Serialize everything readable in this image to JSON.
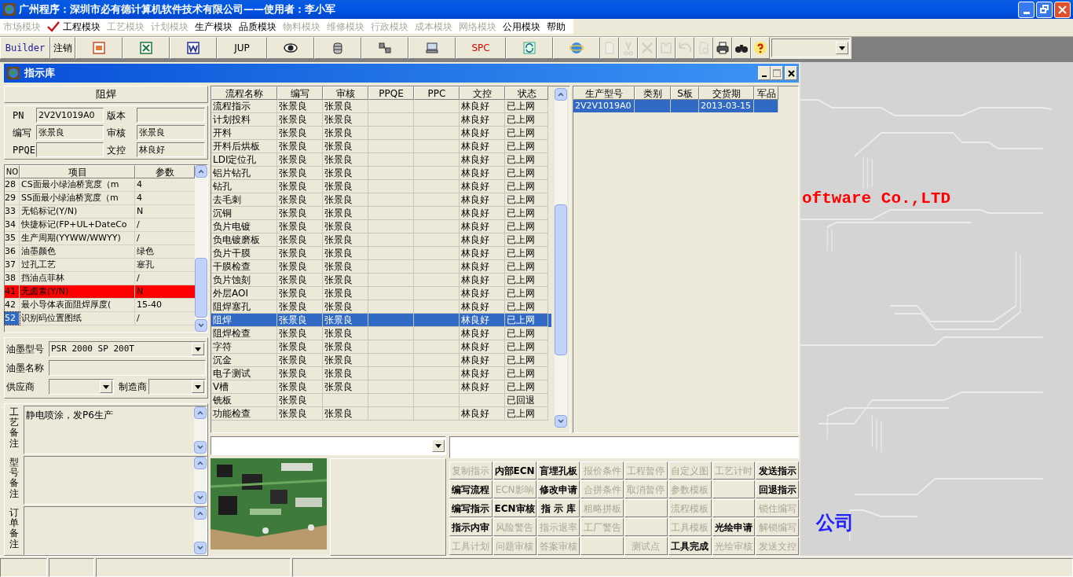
{
  "window": {
    "title": "广州程序：深圳市必有德计算机软件技术有限公司——使用者：李小军"
  },
  "menu": [
    {
      "label": "市场模块",
      "disabled": true,
      "checked": false
    },
    {
      "label": "工程模块",
      "disabled": false,
      "checked": true
    },
    {
      "label": "工艺模块",
      "disabled": true,
      "checked": false
    },
    {
      "label": "计划模块",
      "disabled": true,
      "checked": false
    },
    {
      "label": "生产模块",
      "disabled": false,
      "checked": false
    },
    {
      "label": "品质模块",
      "disabled": false,
      "checked": false
    },
    {
      "label": "物料模块",
      "disabled": true,
      "checked": false
    },
    {
      "label": "维修模块",
      "disabled": true,
      "checked": false
    },
    {
      "label": "行政模块",
      "disabled": true,
      "checked": false
    },
    {
      "label": "成本模块",
      "disabled": true,
      "checked": false
    },
    {
      "label": "网络模块",
      "disabled": true,
      "checked": false
    },
    {
      "label": "公用模块",
      "disabled": false,
      "checked": false
    },
    {
      "label": "帮助",
      "disabled": false,
      "checked": false
    }
  ],
  "toolbar": [
    {
      "kind": "label",
      "label": "Builder",
      "color": "#1c1ca0"
    },
    {
      "kind": "label",
      "label": "注销"
    },
    {
      "kind": "icon",
      "disabled": false
    },
    {
      "kind": "icon",
      "disabled": false
    },
    {
      "kind": "icon",
      "disabled": false
    },
    {
      "kind": "label",
      "label": "JUP"
    },
    {
      "kind": "icon",
      "disabled": false
    },
    {
      "kind": "icon",
      "disabled": false
    },
    {
      "kind": "icon",
      "disabled": false
    },
    {
      "kind": "icon",
      "disabled": false
    },
    {
      "kind": "label",
      "label": "SPC",
      "color": "#e00000"
    },
    {
      "kind": "icon",
      "disabled": false
    },
    {
      "kind": "icon",
      "disabled": false
    },
    {
      "kind": "icon",
      "disabled": true
    },
    {
      "kind": "icon",
      "disabled": true
    },
    {
      "kind": "icon",
      "disabled": true
    },
    {
      "kind": "icon",
      "disabled": true
    },
    {
      "kind": "icon",
      "disabled": true
    },
    {
      "kind": "icon",
      "disabled": true
    },
    {
      "kind": "icon",
      "disabled": false
    },
    {
      "kind": "icon",
      "disabled": false
    },
    {
      "kind": "icon",
      "disabled": false
    }
  ],
  "child_window": {
    "title": "指示库"
  },
  "process_header": "阻焊",
  "fields": [
    {
      "label": "PN",
      "value": "2V2V1019A0"
    },
    {
      "label": "版本"
    },
    {
      "label": "编写",
      "value": "张景良"
    },
    {
      "label": "审核",
      "value": "张景良"
    },
    {
      "label": "PPQE"
    },
    {
      "label": "文控",
      "value": "林良好"
    }
  ],
  "params": {
    "columns": [
      "NO",
      "项目",
      "参数"
    ],
    "rows": [
      {
        "no": "28",
        "item": "CS面最小绿油桥宽度（m",
        "value": "4",
        "highlighted": false,
        "focused": false
      },
      {
        "no": "29",
        "item": "SS面最小绿油桥宽度（m",
        "value": "4",
        "highlighted": false,
        "focused": false
      },
      {
        "no": "33",
        "item": "无铅标记(Y/N)",
        "value": "N",
        "highlighted": false,
        "focused": false
      },
      {
        "no": "34",
        "item": "快捷标记(FP+UL+DateCo",
        "value": "/",
        "highlighted": false,
        "focused": false
      },
      {
        "no": "35",
        "item": "生产周期(YYWW/WWYY)",
        "value": "/",
        "highlighted": false,
        "focused": false
      },
      {
        "no": "36",
        "item": "油墨颜色",
        "value": "绿色",
        "highlighted": false,
        "focused": false
      },
      {
        "no": "37",
        "item": "过孔工艺",
        "value": "塞孔",
        "highlighted": false,
        "focused": false
      },
      {
        "no": "38",
        "item": "挡油点菲林",
        "value": "/",
        "highlighted": false,
        "focused": false
      },
      {
        "no": "41",
        "item": "无卤素(Y/N)",
        "value": "N",
        "highlighted": true,
        "focused": false
      },
      {
        "no": "42",
        "item": "最小导体表面阻焊厚度(",
        "value": "15-40",
        "highlighted": false,
        "focused": false
      },
      {
        "no": "52",
        "item": "识别码位置图纸",
        "value": "/",
        "highlighted": false,
        "focused": true
      }
    ]
  },
  "ink": {
    "model_label": "油墨型号",
    "model": "PSR 2000 SP 200T",
    "name_label": "油墨名称",
    "supplier_label": "供应商",
    "maker_label": "制造商"
  },
  "remarks": [
    {
      "label": "工艺备注",
      "text": "静电喷涂，发P6生产"
    },
    {
      "label": "型号备注"
    },
    {
      "label": "订单备注"
    }
  ],
  "flow_table": {
    "columns": [
      "流程名称",
      "编写",
      "审核",
      "PPQE",
      "PPC",
      "文控",
      "状态"
    ],
    "rows": [
      {
        "name": "流程指示",
        "writer": "张景良",
        "reviewer": "张景良",
        "doc_control": "林良好",
        "status": "已上网",
        "selected": false
      },
      {
        "name": "计划投料",
        "writer": "张景良",
        "reviewer": "张景良",
        "doc_control": "林良好",
        "status": "已上网",
        "selected": false
      },
      {
        "name": "开料",
        "writer": "张景良",
        "reviewer": "张景良",
        "doc_control": "林良好",
        "status": "已上网",
        "selected": false
      },
      {
        "name": "开料后烘板",
        "writer": "张景良",
        "reviewer": "张景良",
        "doc_control": "林良好",
        "status": "已上网",
        "selected": false
      },
      {
        "name": "LDI定位孔",
        "writer": "张景良",
        "reviewer": "张景良",
        "doc_control": "林良好",
        "status": "已上网",
        "selected": false
      },
      {
        "name": "铝片钻孔",
        "writer": "张景良",
        "reviewer": "张景良",
        "doc_control": "林良好",
        "status": "已上网",
        "selected": false
      },
      {
        "name": "钻孔",
        "writer": "张景良",
        "reviewer": "张景良",
        "doc_control": "林良好",
        "status": "已上网",
        "selected": false
      },
      {
        "name": "去毛刺",
        "writer": "张景良",
        "reviewer": "张景良",
        "doc_control": "林良好",
        "status": "已上网",
        "selected": false
      },
      {
        "name": "沉铜",
        "writer": "张景良",
        "reviewer": "张景良",
        "doc_control": "林良好",
        "status": "已上网",
        "selected": false
      },
      {
        "name": "负片电镀",
        "writer": "张景良",
        "reviewer": "张景良",
        "doc_control": "林良好",
        "status": "已上网",
        "selected": false
      },
      {
        "name": "负电镀磨板",
        "writer": "张景良",
        "reviewer": "张景良",
        "doc_control": "林良好",
        "status": "已上网",
        "selected": false
      },
      {
        "name": "负片干膜",
        "writer": "张景良",
        "reviewer": "张景良",
        "doc_control": "林良好",
        "status": "已上网",
        "selected": false
      },
      {
        "name": "干膜检查",
        "writer": "张景良",
        "reviewer": "张景良",
        "doc_control": "林良好",
        "status": "已上网",
        "selected": false
      },
      {
        "name": "负片蚀刻",
        "writer": "张景良",
        "reviewer": "张景良",
        "doc_control": "林良好",
        "status": "已上网",
        "selected": false
      },
      {
        "name": "外层AOI",
        "writer": "张景良",
        "reviewer": "张景良",
        "doc_control": "林良好",
        "status": "已上网",
        "selected": false
      },
      {
        "name": "阻焊塞孔",
        "writer": "张景良",
        "reviewer": "张景良",
        "doc_control": "林良好",
        "status": "已上网",
        "selected": false
      },
      {
        "name": "阻焊",
        "writer": "张景良",
        "reviewer": "张景良",
        "doc_control": "林良好",
        "status": "已上网",
        "selected": true
      },
      {
        "name": "阻焊检查",
        "writer": "张景良",
        "reviewer": "张景良",
        "doc_control": "林良好",
        "status": "已上网",
        "selected": false
      },
      {
        "name": "字符",
        "writer": "张景良",
        "reviewer": "张景良",
        "doc_control": "林良好",
        "status": "已上网",
        "selected": false
      },
      {
        "name": "沉金",
        "writer": "张景良",
        "reviewer": "张景良",
        "doc_control": "林良好",
        "status": "已上网",
        "selected": false
      },
      {
        "name": "电子测试",
        "writer": "张景良",
        "reviewer": "张景良",
        "doc_control": "林良好",
        "status": "已上网",
        "selected": false
      },
      {
        "name": "V槽",
        "writer": "张景良",
        "reviewer": "张景良",
        "doc_control": "林良好",
        "status": "已上网",
        "selected": false
      },
      {
        "name": "铣板",
        "writer": "张景良",
        "status": "已回退",
        "selected": false
      },
      {
        "name": "功能检查",
        "writer": "张景良",
        "reviewer": "张景良",
        "doc_control": "林良好",
        "status": "已上网",
        "selected": false
      }
    ]
  },
  "model_table": {
    "columns": [
      "生产型号",
      "类别",
      "S板",
      "交货期",
      "军品"
    ],
    "rows": [
      {
        "model": "2V2V1019A0",
        "delivery": "2013-03-15",
        "selected": true
      }
    ]
  },
  "actions": [
    {
      "kind": "button",
      "label": "复制指示",
      "disabled": true
    },
    {
      "kind": "button",
      "label": "内部ECN",
      "disabled": false
    },
    {
      "kind": "button",
      "label": "盲埋孔板",
      "disabled": false
    },
    {
      "kind": "button",
      "label": "报价条件",
      "disabled": true
    },
    {
      "kind": "button",
      "label": "工程暂停",
      "disabled": true
    },
    {
      "kind": "button",
      "label": "自定义图",
      "disabled": true
    },
    {
      "kind": "button",
      "label": "工艺计时",
      "disabled": true
    },
    {
      "kind": "button",
      "label": "发送指示",
      "disabled": false
    },
    {
      "kind": "button",
      "label": "编写流程",
      "disabled": false
    },
    {
      "kind": "button",
      "label": "ECN影响",
      "disabled": true
    },
    {
      "kind": "button",
      "label": "修改申请",
      "disabled": false
    },
    {
      "kind": "button",
      "label": "合拼条件",
      "disabled": true
    },
    {
      "kind": "button",
      "label": "取消暂停",
      "disabled": true
    },
    {
      "kind": "button",
      "label": "参数模板",
      "disabled": true
    },
    {
      "kind": "empty"
    },
    {
      "kind": "button",
      "label": "回退指示",
      "disabled": false
    },
    {
      "kind": "button",
      "label": "编写指示",
      "disabled": false
    },
    {
      "kind": "button",
      "label": "ECN审核",
      "disabled": false
    },
    {
      "kind": "button",
      "label": "指 示 库",
      "disabled": false
    },
    {
      "kind": "button",
      "label": "粗略拼板",
      "disabled": true
    },
    {
      "kind": "empty"
    },
    {
      "kind": "button",
      "label": "流程模板",
      "disabled": true
    },
    {
      "kind": "empty"
    },
    {
      "kind": "button",
      "label": "锁住编写",
      "disabled": true
    },
    {
      "kind": "button",
      "label": "指示内审",
      "disabled": false
    },
    {
      "kind": "button",
      "label": "风险警告",
      "disabled": true
    },
    {
      "kind": "button",
      "label": "指示退率",
      "disabled": true
    },
    {
      "kind": "button",
      "label": "工厂警告",
      "disabled": true
    },
    {
      "kind": "empty"
    },
    {
      "kind": "button",
      "label": "工具模板",
      "disabled": true
    },
    {
      "kind": "button",
      "label": "光绘申请",
      "disabled": false
    },
    {
      "kind": "button",
      "label": "解锁编写",
      "disabled": true
    },
    {
      "kind": "button",
      "label": "工具计划",
      "disabled": true
    },
    {
      "kind": "button",
      "label": "问题审核",
      "disabled": true
    },
    {
      "kind": "button",
      "label": "答案审核",
      "disabled": true
    },
    {
      "kind": "empty"
    },
    {
      "kind": "button",
      "label": "测试点",
      "disabled": true
    },
    {
      "kind": "button",
      "label": "工具完成",
      "disabled": false
    },
    {
      "kind": "button",
      "label": "光绘审核",
      "disabled": true
    },
    {
      "kind": "button",
      "label": "发送文控",
      "disabled": true
    }
  ],
  "desktop_texts": [
    {
      "text": "oftware Co.,LTD",
      "color": "#ff0000"
    },
    {
      "text": "公司",
      "color": "#2020ff"
    }
  ]
}
